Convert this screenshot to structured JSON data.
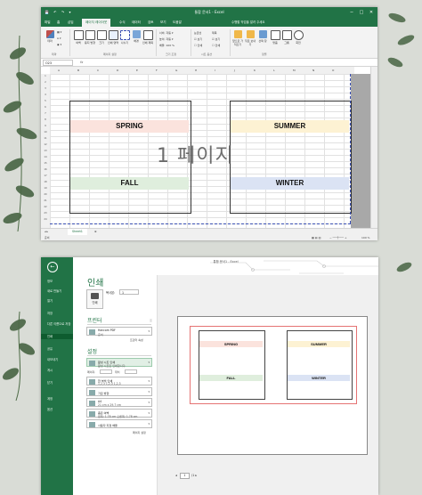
{
  "colors": {
    "excel_green": "#217346",
    "spring": "#fbe3dd",
    "summer": "#fdf2d3",
    "fall": "#dfeedd",
    "winter": "#dbe3f4"
  },
  "top": {
    "title": "통합 문서1 - Excel",
    "window_controls": [
      "─",
      "□",
      "✕"
    ],
    "tabs": [
      "파일",
      "홈",
      "삽입",
      "페이지 레이아웃",
      "수식",
      "데이터",
      "검토",
      "보기",
      "도움말"
    ],
    "active_tab_index": 3,
    "search_text": "수행할 작업을 알려 주세요",
    "ribbon_buttons": [
      "테마",
      "여백",
      "용지 방향",
      "크기",
      "인쇄 영역",
      "나누기",
      "배경",
      "인쇄 제목"
    ],
    "ribbon_small": {
      "width": "너비:",
      "height": "높이:",
      "scale": "배율:",
      "scale_value": "100 %",
      "auto": "자동",
      "gridlines": "눈금선",
      "headings": "제목",
      "view": "보기",
      "print": "인쇄"
    },
    "arrange_buttons": [
      "앞으로 가져오기",
      "뒤로 보내기",
      "선택 창",
      "맞춤",
      "그룹",
      "회전"
    ],
    "groups": [
      "테마",
      "페이지 설정",
      "크기 조정",
      "시트 옵션",
      "정렬"
    ],
    "name_box": "O23",
    "fx": "fx",
    "columns": [
      "A",
      "B",
      "C",
      "D",
      "E",
      "F",
      "G",
      "H",
      "I",
      "J",
      "K",
      "L",
      "M",
      "N",
      "O"
    ],
    "watermark": "1 페이지",
    "seasons": {
      "spring": "SPRING",
      "summer": "SUMMER",
      "fall": "FALL",
      "winter": "WINTER"
    },
    "sheet_tab": "Sheet1",
    "status_left": "준비",
    "zoom": "100 %"
  },
  "bottom": {
    "title": "통합 문서1 - Excel",
    "side_menu": [
      "정보",
      "새로 만들기",
      "열기",
      "저장",
      "다른 이름으로 저장",
      "인쇄",
      "공유",
      "내보내기",
      "게시",
      "닫기",
      "계정",
      "옵션"
    ],
    "active_side_index": 5,
    "heading": "인쇄",
    "copies_label": "복사본:",
    "copies_value": "1",
    "print_button": "인쇄",
    "printer_section": "프린터",
    "printer_name": "Hancom PDF",
    "printer_status": "준비",
    "printer_props": "프린터 속성",
    "settings_section": "설정",
    "print_what": "활성 시트 인쇄",
    "print_what_sub": "활성 시트만 인쇄합니다.",
    "pages_label": "페이지:",
    "to_label": "위치",
    "collate": "한 부씩 인쇄",
    "collate_sub": "1,2,3  1,2,3  1,2,3",
    "orientation": "가로 방향",
    "paper": "A4",
    "paper_sub": "21 cm x 29.7 cm",
    "margins": "좁은 여백",
    "margins_sub": "왼쪽: 1.78 cm  오른쪽: 1.78 cm",
    "scaling": "사용자 지정 배율",
    "page_setup": "페이지 설정",
    "pager_current": "1",
    "pager_total": "/1"
  }
}
